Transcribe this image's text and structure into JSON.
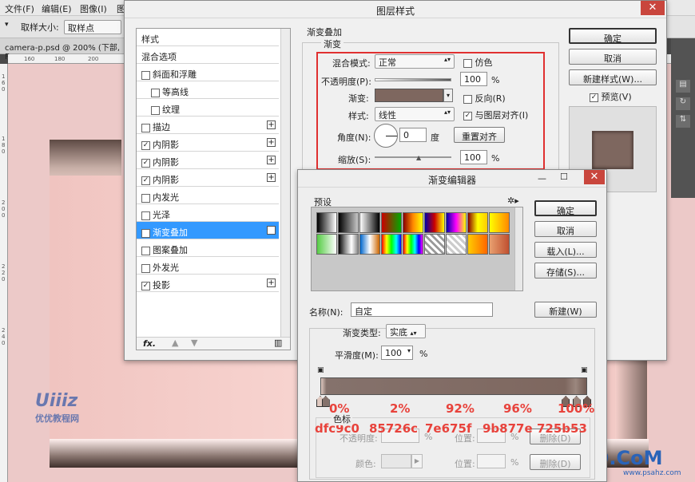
{
  "menubar": {
    "items": [
      "文件(F)",
      "编辑(E)",
      "图像(I)",
      "图"
    ]
  },
  "optbar": {
    "label": "取样大小:",
    "value": "取样点"
  },
  "doc": {
    "tab": "camera-p.psd @ 200% (下部, F"
  },
  "ruler": {
    "ticks": [
      "160",
      "180",
      "200",
      "640"
    ],
    "vticks": [
      "1",
      "6",
      "0",
      "1",
      "8",
      "0",
      "2",
      "0",
      "0",
      "2",
      "2",
      "0",
      "2",
      "4",
      "0"
    ]
  },
  "watermark": {
    "text": "优优教程网",
    "brand": "UiBQ.CoM",
    "site": "www.psahz.com"
  },
  "layer_style": {
    "title": "图层样式",
    "list_header": "样式",
    "items": [
      {
        "label": "混合选项",
        "check": false,
        "checked": false,
        "plus": false
      },
      {
        "label": "斜面和浮雕",
        "check": true,
        "checked": false,
        "plus": false
      },
      {
        "label": "等高线",
        "check": true,
        "checked": false,
        "plus": false,
        "sub": true
      },
      {
        "label": "纹理",
        "check": true,
        "checked": false,
        "plus": false,
        "sub": true
      },
      {
        "label": "描边",
        "check": true,
        "checked": false,
        "plus": true
      },
      {
        "label": "内阴影",
        "check": true,
        "checked": true,
        "plus": true
      },
      {
        "label": "内阴影",
        "check": true,
        "checked": true,
        "plus": true
      },
      {
        "label": "内阴影",
        "check": true,
        "checked": true,
        "plus": true
      },
      {
        "label": "内发光",
        "check": true,
        "checked": false,
        "plus": false
      },
      {
        "label": "光泽",
        "check": true,
        "checked": false,
        "plus": false
      },
      {
        "label": "渐变叠加",
        "check": true,
        "checked": true,
        "plus": true,
        "selected": true
      },
      {
        "label": "图案叠加",
        "check": true,
        "checked": false,
        "plus": false
      },
      {
        "label": "外发光",
        "check": true,
        "checked": false,
        "plus": false
      },
      {
        "label": "投影",
        "check": true,
        "checked": true,
        "plus": true
      }
    ],
    "fx": "fx.",
    "section_title": "渐变叠加",
    "group_title": "渐变",
    "blend_label": "混合模式:",
    "blend_value": "正常",
    "dither_label": "仿色",
    "opacity_label": "不透明度(P):",
    "opacity_value": "100",
    "opacity_unit": "%",
    "gradient_label": "渐变:",
    "reverse_label": "反向(R)",
    "style_label": "样式:",
    "style_value": "线性",
    "align_label": "与图层对齐(I)",
    "angle_label": "角度(N):",
    "angle_value": "0",
    "angle_unit": "度",
    "reset_align": "重置对齐",
    "scale_label": "缩放(S):",
    "scale_value": "100",
    "scale_unit": "%",
    "ok": "确定",
    "cancel": "取消",
    "new_style": "新建样式(W)...",
    "preview_label": "预览(V)"
  },
  "gradient_editor": {
    "title": "渐变编辑器",
    "presets_label": "预设",
    "ok": "确定",
    "cancel": "取消",
    "load": "载入(L)...",
    "save": "存储(S)...",
    "name_label": "名称(N):",
    "name_value": "自定",
    "new_button": "新建(W)",
    "type_label": "渐变类型:",
    "type_value": "实底",
    "smooth_label": "平滑度(M):",
    "smooth_value": "100",
    "smooth_unit": "%",
    "stops_title": "色标",
    "opacity_label": "不透明度:",
    "pct": "%",
    "position_label": "位置:",
    "delete_label": "删除(D)",
    "color_label": "颜色:",
    "stops": [
      {
        "pct": "0%",
        "hex": "dfc9c0",
        "color": "#dfc9c0"
      },
      {
        "pct": "2%",
        "hex": "85726c",
        "color": "#85726c"
      },
      {
        "pct": "92%",
        "hex": "7e675f",
        "color": "#7e675f"
      },
      {
        "pct": "96%",
        "hex": "9b877e",
        "color": "#9b877e"
      },
      {
        "pct": "100%",
        "hex": "725b53",
        "color": "#725b53"
      }
    ]
  },
  "colors": {
    "accent": "#3399ff",
    "annotation_red": "#e8433c",
    "highlight_box": "#e03030"
  }
}
